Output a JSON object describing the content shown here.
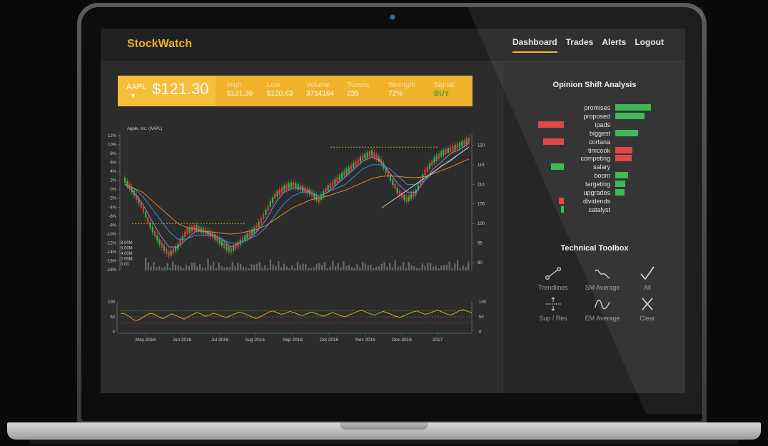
{
  "app": {
    "logo": "StockWatch",
    "nav": [
      "Dashboard",
      "Trades",
      "Alerts",
      "Logout"
    ],
    "active_nav": "Dashboard",
    "accent": "#f0b22a"
  },
  "ticker": {
    "symbol": "AAPL",
    "arrow": "▼",
    "price": "$121.30",
    "stats": [
      {
        "label": "High",
        "value": "$121.39"
      },
      {
        "label": "Low",
        "value": "$120.63"
      },
      {
        "label": "Volume",
        "value": "3714164"
      },
      {
        "label": "Tweets",
        "value": "235"
      },
      {
        "label": "Strength",
        "value": "72%"
      },
      {
        "label": "Signal",
        "value": "BUY"
      }
    ]
  },
  "chart_data": [
    {
      "type": "line",
      "title": "Apple, Inc. (AAPL)",
      "x_tick_labels": [
        "May 2016",
        "Jun 2016",
        "Jul 2016",
        "Aug 2016",
        "Sep 2016",
        "Oct 2016",
        "Nov 2016",
        "Dec 2016",
        "2017"
      ],
      "y_left_tick_labels": [
        "12%",
        "10%",
        "8%",
        "6%",
        "4%",
        "2%",
        "0%",
        "-2%",
        "-4%",
        "-6%",
        "-8%",
        "-10%",
        "-12%",
        "-14%",
        "-16%",
        "-18%"
      ],
      "y_right_tick_labels": [
        "120",
        "115",
        "110",
        "105",
        "100",
        "95",
        "90"
      ],
      "volume_tick_labels": [
        "8.00M",
        "6.00M",
        "4.00M",
        "2.00M",
        "0.00"
      ],
      "ylim_price": [
        88,
        123
      ],
      "series": [
        {
          "name": "",
          "color": "#2fb54a",
          "values": [
            111,
            108,
            104,
            99,
            95,
            92,
            94,
            98,
            99,
            98,
            97,
            95,
            93,
            95,
            97,
            99,
            103,
            107,
            109,
            110,
            109,
            108,
            106,
            109,
            111,
            113,
            115,
            117,
            118,
            116,
            112,
            108,
            106,
            108,
            113,
            116,
            118,
            119,
            120,
            121.3
          ]
        },
        {
          "name": "",
          "color": "#b57ad1",
          "values": [
            110,
            108,
            105,
            101,
            97,
            94,
            94,
            96,
            98,
            98,
            97,
            96,
            94,
            95,
            96,
            98,
            101,
            105,
            108,
            109,
            109,
            108,
            107,
            108,
            110,
            112,
            114,
            116,
            117,
            116,
            113,
            110,
            108,
            108,
            111,
            114,
            116,
            118,
            119,
            120.5
          ]
        },
        {
          "name": "",
          "color": "#3a8fd8",
          "values": [
            110,
            109,
            107,
            104,
            101,
            98,
            96,
            96,
            97,
            97,
            97,
            96,
            95,
            95,
            96,
            97,
            99,
            102,
            105,
            107,
            108,
            108,
            107,
            108,
            109,
            110,
            112,
            114,
            115,
            115,
            114,
            112,
            110,
            110,
            111,
            113,
            115,
            116,
            118,
            119.5
          ]
        },
        {
          "name": "",
          "color": "#e0872a",
          "values": [
            110,
            109,
            108,
            106,
            104,
            102,
            100,
            99,
            98.5,
            98,
            97.8,
            97.5,
            97.3,
            97.5,
            98,
            98.5,
            99.5,
            101,
            102.5,
            104,
            105,
            106,
            106.5,
            107,
            107.8,
            108.5,
            109.5,
            110.5,
            111.5,
            112,
            112.2,
            112,
            111.8,
            111.7,
            112,
            112.8,
            113.6,
            114.5,
            115.5,
            116.5
          ]
        }
      ],
      "resistance_levels": [
        100,
        119.5
      ],
      "trendline": {
        "from": [
          111,
          104
        ],
        "to": [
          159,
          119.5
        ]
      }
    },
    {
      "type": "line",
      "y_tick_labels": [
        "100",
        "50",
        "0"
      ],
      "ylim": [
        0,
        100
      ],
      "series": [
        {
          "name": "",
          "color": "#e0a52a",
          "values": [
            62,
            60,
            52,
            40,
            38,
            46,
            55,
            62,
            58,
            50,
            44,
            52,
            60,
            55,
            48,
            42,
            50,
            58,
            64,
            60,
            52,
            56,
            62,
            58,
            52,
            48,
            54,
            60,
            66,
            62,
            56,
            50,
            44,
            50,
            58,
            66,
            70,
            64,
            58,
            62,
            68,
            64,
            58,
            54,
            60,
            66,
            62,
            56,
            52,
            58,
            64,
            60,
            54,
            50,
            56,
            62,
            68,
            72,
            66,
            60,
            56,
            62,
            68,
            64,
            58,
            52,
            48,
            54,
            60,
            66,
            70,
            64,
            58,
            62,
            68,
            72,
            66,
            60,
            56,
            62,
            70,
            74,
            68,
            64
          ]
        }
      ],
      "reference_levels": [
        70,
        50,
        30
      ]
    }
  ],
  "opinion": {
    "title": "Opinion Shift Analysis",
    "items": [
      {
        "word": "promises",
        "value": 0.55,
        "color": "#2fb54a"
      },
      {
        "word": "proposed",
        "value": 0.45,
        "color": "#2fb54a"
      },
      {
        "word": "ipads",
        "value": -0.4,
        "color": "#e03a3a"
      },
      {
        "word": "biggest",
        "value": 0.35,
        "color": "#2fb54a"
      },
      {
        "word": "cortana",
        "value": -0.32,
        "color": "#e03a3a"
      },
      {
        "word": "timcook",
        "value": 0.27,
        "color": "#e03a3a"
      },
      {
        "word": "competing",
        "value": 0.25,
        "color": "#e03a3a"
      },
      {
        "word": "salary",
        "value": -0.2,
        "color": "#2fb54a"
      },
      {
        "word": "boom",
        "value": 0.2,
        "color": "#2fb54a"
      },
      {
        "word": "targeting",
        "value": 0.16,
        "color": "#2fb54a"
      },
      {
        "word": "upgrades",
        "value": 0.14,
        "color": "#2fb54a"
      },
      {
        "word": "dividends",
        "value": -0.08,
        "color": "#e03a3a"
      },
      {
        "word": "catalyst",
        "value": -0.05,
        "color": "#2fb54a"
      }
    ]
  },
  "toolbox": {
    "title": "Technical Toolbox",
    "tools": [
      {
        "label": "Trendlines",
        "icon": "trendline-icon"
      },
      {
        "label": "SM Average",
        "icon": "sm-average-icon"
      },
      {
        "label": "All",
        "icon": "check-icon"
      },
      {
        "label": "Sup / Res",
        "icon": "support-resistance-icon"
      },
      {
        "label": "EM Average",
        "icon": "em-average-icon"
      },
      {
        "label": "Clear",
        "icon": "clear-x-icon"
      }
    ]
  }
}
